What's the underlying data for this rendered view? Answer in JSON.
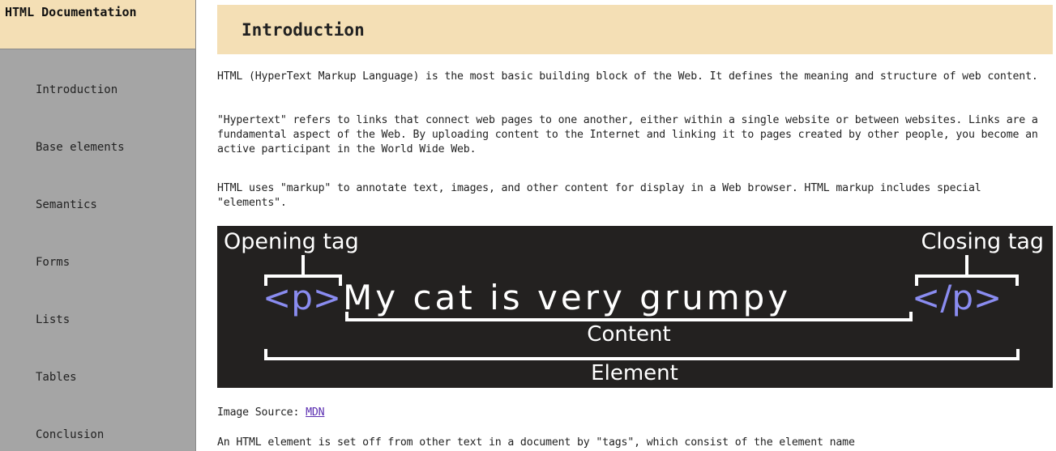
{
  "sidebar": {
    "title": "HTML Documentation",
    "items": [
      {
        "label": "Introduction"
      },
      {
        "label": "Base elements"
      },
      {
        "label": "Semantics"
      },
      {
        "label": "Forms"
      },
      {
        "label": "Lists"
      },
      {
        "label": "Tables"
      },
      {
        "label": "Conclusion"
      }
    ]
  },
  "main": {
    "section_title": "Introduction",
    "paragraphs": [
      "HTML (HyperText Markup Language) is the most basic building block of the Web. It defines the meaning and structure of web content.",
      "\"Hypertext\" refers to links that connect web pages to one another, either within a single website or between websites. Links are a fundamental aspect of the Web. By uploading content to the Internet and linking it to pages created by other people, you become an active participant in the World Wide Web.",
      "HTML uses \"markup\" to annotate text, images, and other content for display in a Web browser. HTML markup includes special \"elements\"."
    ],
    "diagram": {
      "opening_tag_label": "Opening tag",
      "closing_tag_label": "Closing tag",
      "open_tag": "<p>",
      "content_text": "My cat is very grumpy",
      "close_tag": "</p>",
      "content_label": "Content",
      "element_label": "Element"
    },
    "image_source_prefix": "Image Source: ",
    "image_source_link": "MDN",
    "paragraph_after": "An HTML element is set off from other text in a document by \"tags\", which consist of the element name"
  },
  "colors": {
    "header_bg": "#f4dfb5",
    "sidebar_bg": "#a5a5a5",
    "diagram_bg": "#232120",
    "tag_color": "#8a8cf0",
    "link_color": "#5a2db0"
  }
}
